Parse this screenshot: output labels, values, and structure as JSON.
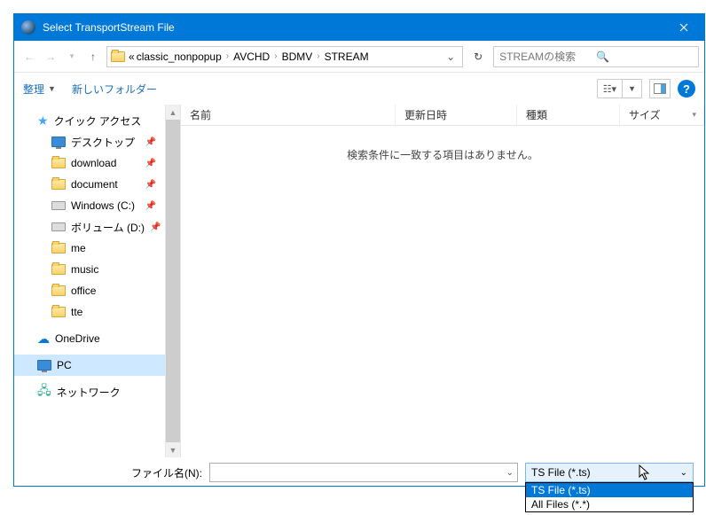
{
  "title": "Select TransportStream File",
  "breadcrumbs": {
    "prefix": "«",
    "items": [
      "classic_nonpopup",
      "AVCHD",
      "BDMV",
      "STREAM"
    ]
  },
  "search_placeholder": "STREAMの検索",
  "toolbar": {
    "organize": "整理",
    "new_folder": "新しいフォルダー",
    "help": "?"
  },
  "sidebar": {
    "quick_access": "クイック アクセス",
    "items": [
      {
        "label": "デスクトップ",
        "pinned": true,
        "icon": "desktop"
      },
      {
        "label": "download",
        "pinned": true,
        "icon": "folder"
      },
      {
        "label": "document",
        "pinned": true,
        "icon": "folder"
      },
      {
        "label": "Windows (C:)",
        "pinned": true,
        "icon": "drive"
      },
      {
        "label": "ボリューム (D:)",
        "pinned": true,
        "icon": "drive"
      },
      {
        "label": "me",
        "pinned": false,
        "icon": "folder"
      },
      {
        "label": "music",
        "pinned": false,
        "icon": "folder"
      },
      {
        "label": "office",
        "pinned": false,
        "icon": "folder"
      },
      {
        "label": "tte",
        "pinned": false,
        "icon": "folder"
      }
    ],
    "onedrive": "OneDrive",
    "pc": "PC",
    "network": "ネットワーク"
  },
  "columns": {
    "name": "名前",
    "date": "更新日時",
    "type": "種類",
    "size": "サイズ"
  },
  "empty_message": "検索条件に一致する項目はありません。",
  "footer": {
    "filename_label": "ファイル名(N):",
    "filter_selected": "TS File (*.ts)",
    "filter_options": [
      "TS File (*.ts)",
      "All Files (*.*)"
    ]
  }
}
